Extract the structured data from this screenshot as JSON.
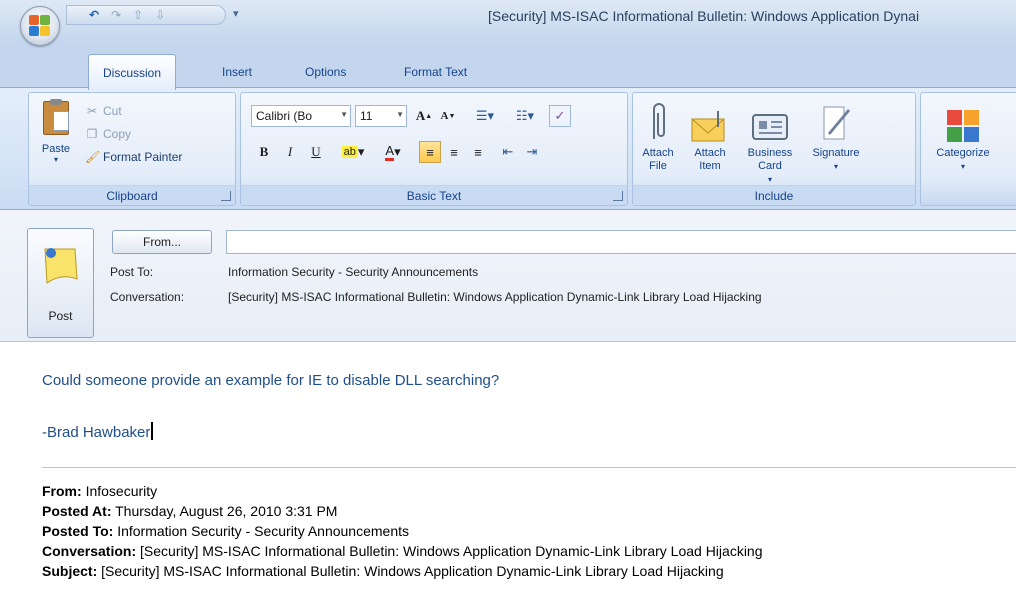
{
  "window": {
    "title": "[Security] MS-ISAC Informational Bulletin: Windows Application Dynai"
  },
  "tabs": [
    {
      "label": "Discussion",
      "active": true
    },
    {
      "label": "Insert",
      "active": false
    },
    {
      "label": "Options",
      "active": false
    },
    {
      "label": "Format Text",
      "active": false
    }
  ],
  "ribbon": {
    "clipboard": {
      "label": "Clipboard",
      "paste": "Paste",
      "cut": "Cut",
      "copy": "Copy",
      "format_painter": "Format Painter"
    },
    "basic_text": {
      "label": "Basic Text",
      "font_name": "Calibri (Bo",
      "font_size": "11",
      "bold": "B",
      "italic": "I",
      "underline": "U"
    },
    "include": {
      "label": "Include",
      "attach_file": "Attach File",
      "attach_item": "Attach Item",
      "business_card": "Business Card",
      "signature": "Signature"
    },
    "options": {
      "categorize": "Categorize"
    }
  },
  "header": {
    "post_button": "Post",
    "from_button": "From...",
    "from_value": "",
    "post_to_label": "Post To:",
    "post_to_value": "Information Security - Security Announcements",
    "conversation_label": "Conversation:",
    "conversation_value": "[Security] MS-ISAC Informational Bulletin: Windows Application  Dynamic-Link Library Load Hijacking"
  },
  "body": {
    "line1": "Could someone provide an example for IE to disable DLL searching?",
    "signature": "-Brad Hawbaker",
    "quoted": {
      "from_label": "From:",
      "from_value": "Infosecurity",
      "posted_at_label": "Posted At:",
      "posted_at_value": "Thursday, August 26, 2010 3:31 PM",
      "posted_to_label": "Posted To:",
      "posted_to_value": "Information Security - Security Announcements",
      "conversation_label": "Conversation:",
      "conversation_value": "[Security] MS-ISAC Informational Bulletin: Windows Application Dynamic-Link Library Load Hijacking",
      "subject_label": "Subject:",
      "subject_value": "[Security] MS-ISAC Informational Bulletin: Windows Application Dynamic-Link Library Load Hijacking"
    }
  },
  "colors": {
    "accent": "#15428b",
    "ribbon_bg": "#d6e4f6",
    "body_text": "#1f4e8c"
  }
}
